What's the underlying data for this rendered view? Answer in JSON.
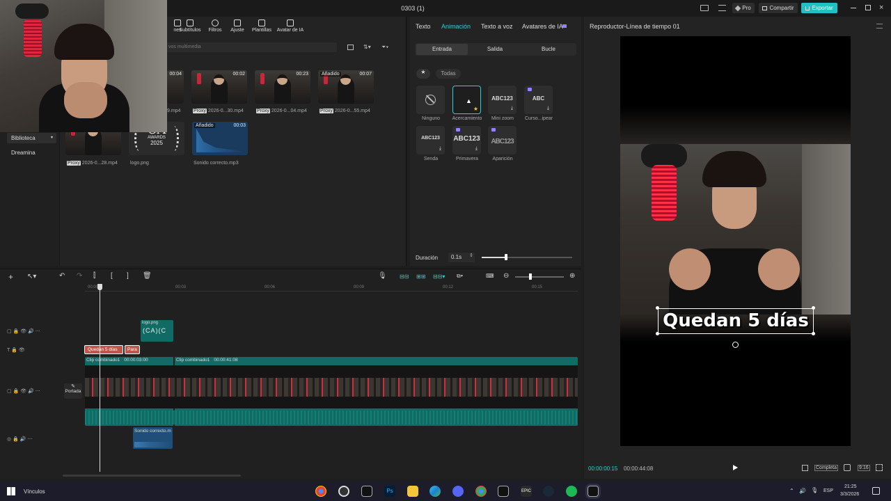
{
  "window": {
    "title": "0303 (1)",
    "pro": "Pro",
    "share": "Compartir",
    "export": "Exportar"
  },
  "media_toolbar": {
    "tools": [
      "nes",
      "Subtítulos",
      "Filtros",
      "Ajuste",
      "Plantillas",
      "Avatar de IA"
    ]
  },
  "media_search_placeholder": "vos multimedia",
  "left_nav": {
    "items": [
      "Biblioteca",
      "Dreamina"
    ]
  },
  "media": {
    "items": [
      {
        "duration": "00:04",
        "name": "9.mp4",
        "proxy": ""
      },
      {
        "duration": "00:02",
        "name": "2026-0...30.mp4",
        "proxy": "Proxy"
      },
      {
        "duration": "00:23",
        "name": "2026-0...04.mp4",
        "proxy": "Proxy"
      },
      {
        "duration": "00:07",
        "name": "2026-0...55.mp4",
        "proxy": "Proxy",
        "added": "Añadido"
      },
      {
        "duration": "",
        "name": "2026-0...28.mp4",
        "proxy": "Proxy"
      },
      {
        "duration": "",
        "name": "logo.png",
        "proxy": ""
      },
      {
        "duration": "00:03",
        "name": "Sonido correcto.mp3",
        "proxy": "",
        "added": "Añadido"
      }
    ],
    "logo_text": {
      "big": "CA",
      "mid": "AWARDS",
      "year": "2025"
    }
  },
  "props": {
    "tabs": [
      "Texto",
      "Animación",
      "Texto a voz",
      "Avatares de IA"
    ],
    "active_tab": "Animación",
    "segments": [
      "Entrada",
      "Salida",
      "Bucle"
    ],
    "filter_all": "Todas",
    "animations": [
      {
        "label": "Ninguno",
        "preview": ""
      },
      {
        "label": "Acercamiento",
        "preview": ""
      },
      {
        "label": "Mini zoom",
        "preview": "ABC123"
      },
      {
        "label": "Curso...ipear",
        "preview": "ABC"
      },
      {
        "label": "Senda",
        "preview": "ABC123"
      },
      {
        "label": "Primavera",
        "preview": "ABC123"
      },
      {
        "label": "Aparición",
        "preview": "ABC123"
      }
    ],
    "duration_label": "Duración",
    "duration_value": "0.1s",
    "duration_fraction": 0.27
  },
  "player": {
    "title": "Reproductor-Línea de tiempo 01",
    "caption": "Quedan 5 días",
    "current_time": "00:00:00:15",
    "total_time": "00:00:44:08",
    "ratio_full": "Completa",
    "ratio": "9:16"
  },
  "timeline": {
    "ticks": [
      "00:00",
      "00:03",
      "00:06",
      "00:09",
      "00:12",
      "00:15"
    ],
    "sticker_clip": "logo.png",
    "text_clips": [
      "Quedan 5 días",
      "Para"
    ],
    "video_clips": [
      {
        "label": "Clip combinado1",
        "time": "00:00:03:00"
      },
      {
        "label": "Clip combinado1",
        "time": "00:00:41:08"
      }
    ],
    "cover_label": "Portada",
    "audio_clip": "Sonido correcto.m"
  },
  "taskbar": {
    "label": "Vínculos",
    "lang": "ESP",
    "time": "21:25",
    "date": "3/3/2026"
  },
  "colors": {
    "accent": "#2fd1d1",
    "export_bg": "#1ec2c2",
    "track_teal": "#0f6b64",
    "text_clip": "#c1554d",
    "audio_clip": "#1f4f78"
  }
}
